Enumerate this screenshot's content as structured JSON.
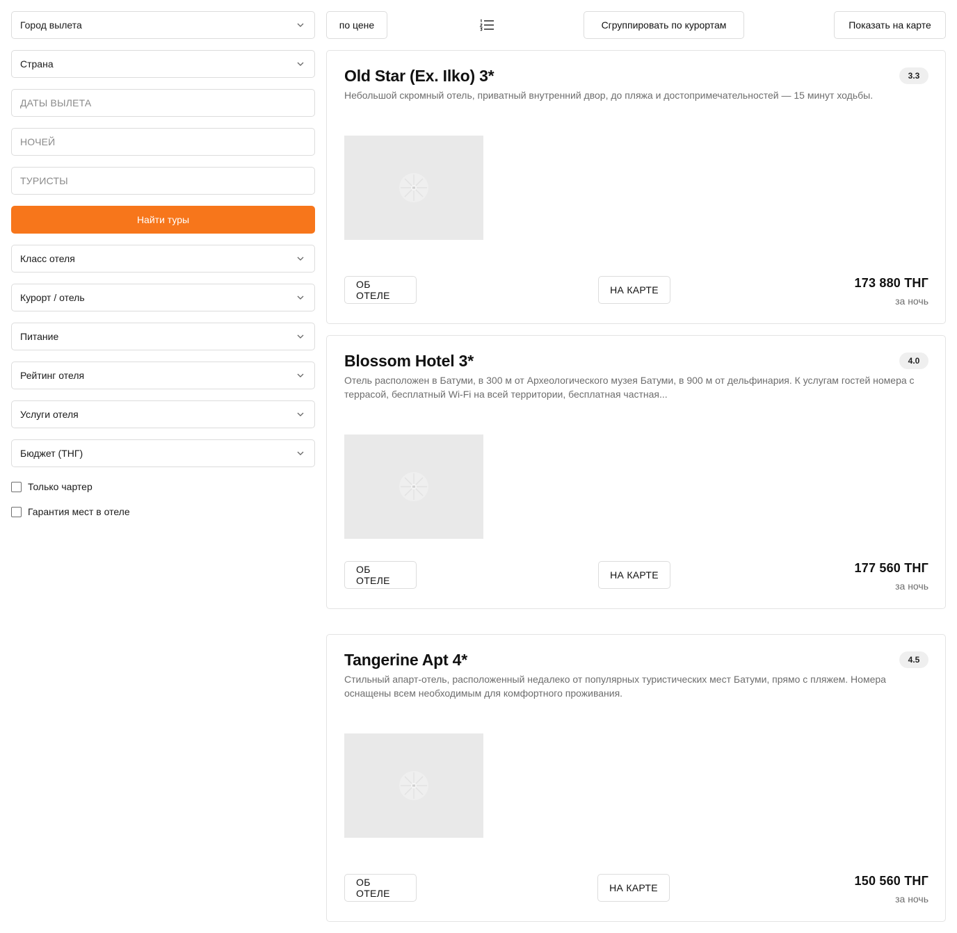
{
  "sidebar": {
    "departure_city": "Город вылета",
    "country": "Страна",
    "dates_placeholder": "ДАТЫ ВЫЛЕТА",
    "nights_placeholder": "НОЧЕЙ",
    "tourists_placeholder": "ТУРИСТЫ",
    "search_button": "Найти туры",
    "filters": [
      "Класс отеля",
      "Курорт / отель",
      "Питание",
      "Рейтинг отеля",
      "Услуги отеля",
      "Бюджет (ТНГ)"
    ],
    "checkboxes": [
      "Только чартер",
      "Гарантия мест в отеле"
    ]
  },
  "toolbar": {
    "sort_label": "по цене",
    "list_icon": "list-icon",
    "group_label": "Сгруппировать по курортам",
    "map_label": "Показать на карте"
  },
  "hotels": [
    {
      "name": "Old Star (Ex. Ilko) 3*",
      "rating": "3.3",
      "description": "Небольшой скромный отель, приватный внутренний двор, до пляжа и достопримечательностей — 15 минут ходьбы.",
      "about_label": "ОБ ОТЕЛЕ",
      "map_label": "НА КАРТЕ",
      "price": "173 880 ТНГ",
      "price_unit": "за ночь"
    },
    {
      "name": "Blossom Hotel 3*",
      "rating": "4.0",
      "description": "Отель расположен в Батуми, в 300 м от Археологического музея Батуми, в 900 м от дельфинария. К услугам гостей номера с террасой, бесплатный Wi-Fi на всей территории, бесплатная частная...",
      "about_label": "ОБ ОТЕЛЕ",
      "map_label": "НА КАРТЕ",
      "price": "177 560 ТНГ",
      "price_unit": "за ночь"
    },
    {
      "name": "Tangerine Apt 4*",
      "rating": "4.5",
      "description": "Стильный апарт-отель, расположенный недалеко от популярных туристических мест Батуми, прямо с пляжем. Номера оснащены всем необходимым для комфортного проживания.",
      "about_label": "ОБ ОТЕЛЕ",
      "map_label": "НА КАРТЕ",
      "price": "150 560 ТНГ",
      "price_unit": "за ночь"
    }
  ],
  "colors": {
    "accent": "#f7761b",
    "border": "#dcdcdc",
    "muted_text": "#6d6d6d",
    "photo_placeholder": "#e9e9e9"
  }
}
